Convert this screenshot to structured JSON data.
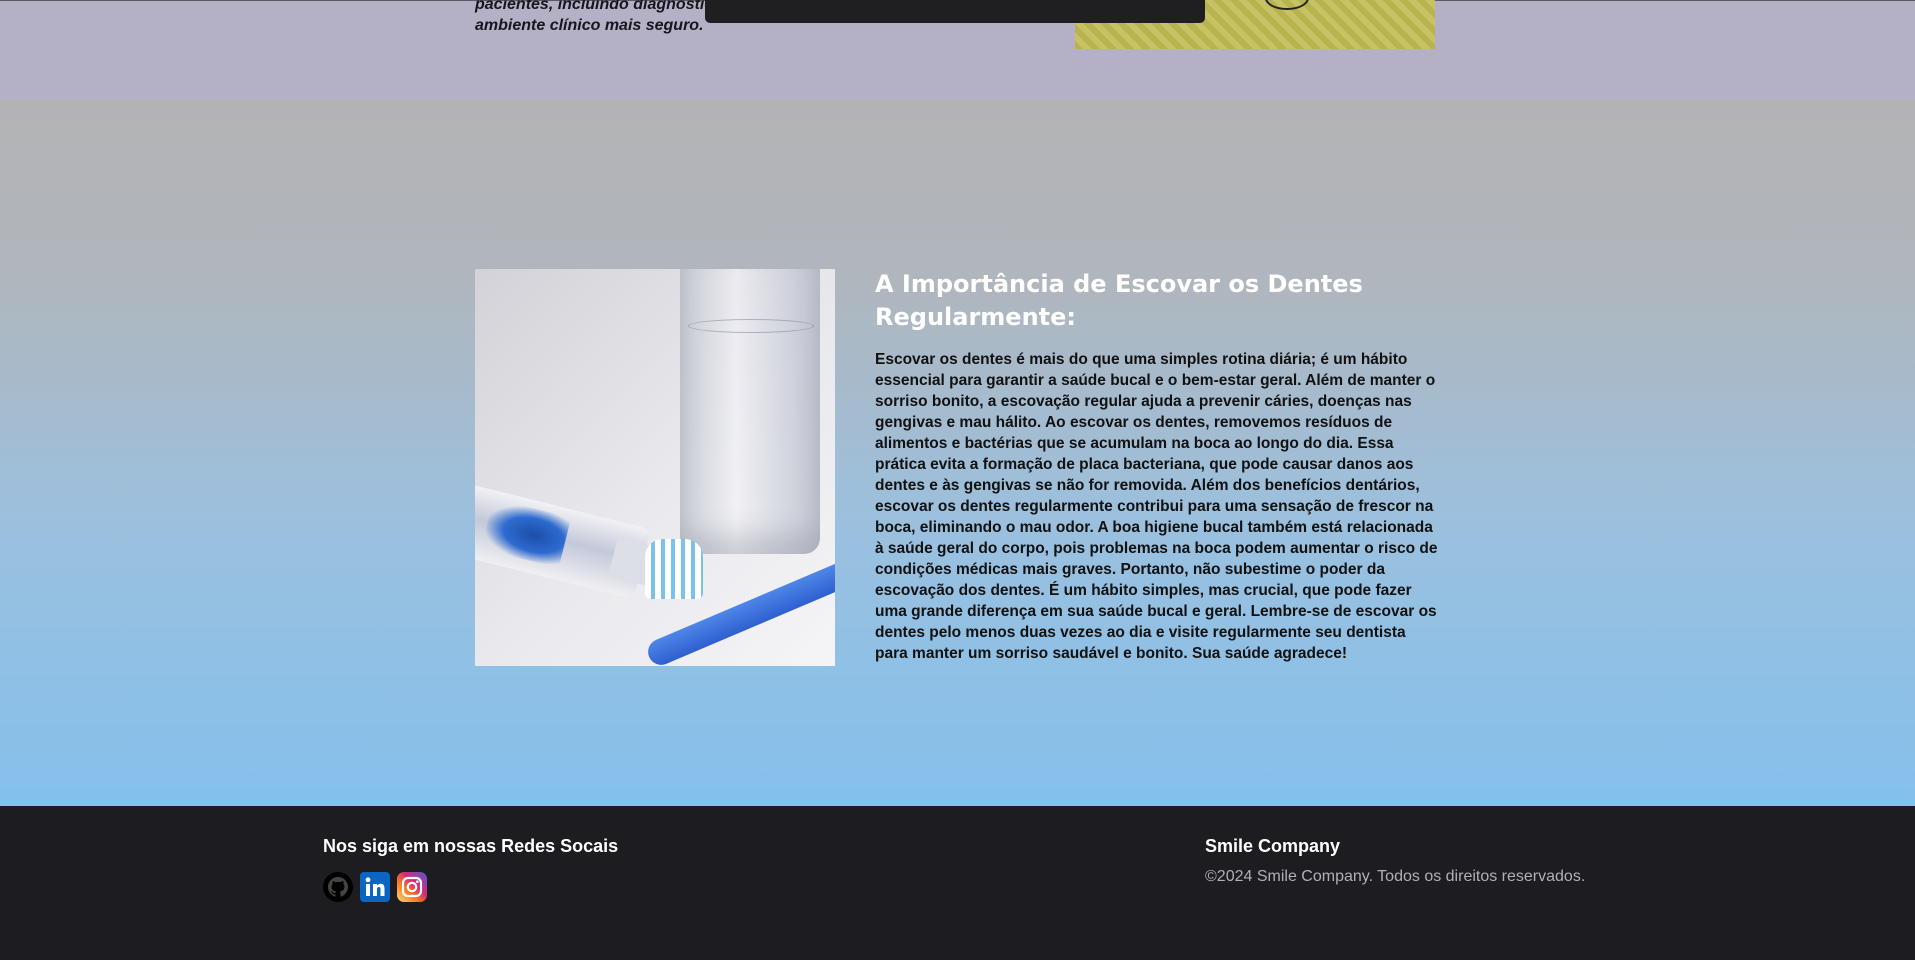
{
  "top_section": {
    "text": "pacientes, incluindo diagnóstico confortáveis, e um ambiente clínico mais seguro."
  },
  "article": {
    "title": "A Importância de Escovar os Dentes Regularmente:",
    "body": "Escovar os dentes é mais do que uma simples rotina diária; é um hábito essencial para garantir a saúde bucal e o bem-estar geral. Além de manter o sorriso bonito, a escovação regular ajuda a prevenir cáries, doenças nas gengivas e mau hálito. Ao escovar os dentes, removemos resíduos de alimentos e bactérias que se acumulam na boca ao longo do dia. Essa prática evita a formação de placa bacteriana, que pode causar danos aos dentes e às gengivas se não for removida. Além dos benefícios dentários, escovar os dentes regularmente contribui para uma sensação de frescor na boca, eliminando o mau odor. A boa higiene bucal também está relacionada à saúde geral do corpo, pois problemas na boca podem aumentar o risco de condições médicas mais graves. Portanto, não subestime o poder da escovação dos dentes. É um hábito simples, mas crucial, que pode fazer uma grande diferença em sua saúde bucal e geral. Lembre-se de escovar os dentes pelo menos duas vezes ao dia e visite regularmente seu dentista para manter um sorriso saudável e bonito. Sua saúde agradece!"
  },
  "footer": {
    "social_heading": "Nos siga em nossas Redes Socais",
    "social_icons": [
      "github-icon",
      "linkedin-icon",
      "instagram-icon"
    ],
    "company_name": "Smile Company",
    "copyright": "©2024 Smile Company. Todos os direitos reservados."
  },
  "colors": {
    "footer_bg": "#1c1c21",
    "title_color": "#ffffff",
    "linkedin_blue": "#0a66c2"
  }
}
